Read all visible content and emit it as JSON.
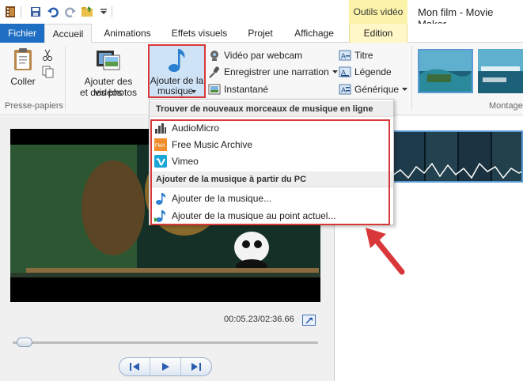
{
  "window": {
    "title": "Mon film - Movie Maker",
    "tools_tab": "Outils vidéo"
  },
  "tabs": [
    "Fichier",
    "Accueil",
    "Animations",
    "Effets visuels",
    "Projet",
    "Affichage",
    "Edition"
  ],
  "ribbon": {
    "clipboard": {
      "paste_label": "Coller",
      "group_label": "Presse-papiers"
    },
    "add_videos": {
      "line1": "Ajouter des vidéos",
      "line2": "et des photos"
    },
    "add_music": {
      "line1": "Ajouter de la",
      "line2": "musique"
    },
    "webcam": "Vidéo par webcam",
    "narration": "Enregistrer une narration",
    "snapshot": "Instantané",
    "title": "Titre",
    "caption": "Légende",
    "credits": "Générique",
    "themes_group_label": "Montage"
  },
  "dropdown": {
    "header_online": "Trouver de nouveaux morceaux de musique en ligne",
    "online_items": [
      "AudioMicro",
      "Free Music Archive",
      "Vimeo"
    ],
    "header_pc": "Ajouter de la musique à partir du PC",
    "pc_items": [
      "Ajouter de la musique...",
      "Ajouter de la musique au point actuel..."
    ]
  },
  "player": {
    "timecode": "00:05.23/02:36.66",
    "seek_fraction": 0.04
  },
  "colors": {
    "accent": "#1e6fc3",
    "highlight": "#d9383a",
    "tools_tab": "#fbf3a9"
  }
}
